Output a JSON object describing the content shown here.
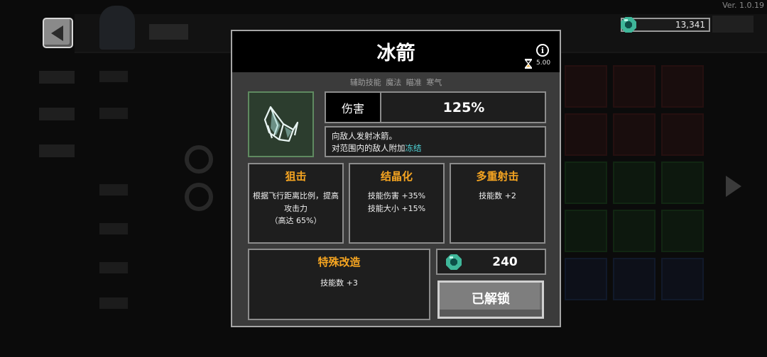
{
  "version": "Ver. 1.0.19",
  "currency": {
    "amount": "13,341",
    "icon": "gem-icon"
  },
  "modal": {
    "title": "冰箭",
    "info_glyph": "i",
    "cooldown": "5.00",
    "tags": "辅助技能 魔法 瞄准 寒气",
    "damage_label": "伤害",
    "damage_value": "125%",
    "desc_line1": "向敌人发射冰箭。",
    "desc_line2_prefix": "对范围内的敌人附加",
    "desc_line2_highlight": "冻结",
    "modifiers": [
      {
        "title": "狙击",
        "desc": "根据飞行距离比例，提高\n攻击力\n（高达 65%）"
      },
      {
        "title": "结晶化",
        "desc": "技能伤害 +35%\n技能大小 +15%"
      },
      {
        "title": "多重射击",
        "desc": "技能数 +2"
      }
    ],
    "special": {
      "title": "特殊改造",
      "desc": "技能数 +3"
    },
    "cost": "240",
    "unlock_label": "已解锁"
  },
  "colors": {
    "accent_orange": "#f6a521",
    "highlight_cyan": "#4fd4d8",
    "gem_green": "#3fb79a",
    "skill_icon_bg": "#2c3d2e"
  }
}
